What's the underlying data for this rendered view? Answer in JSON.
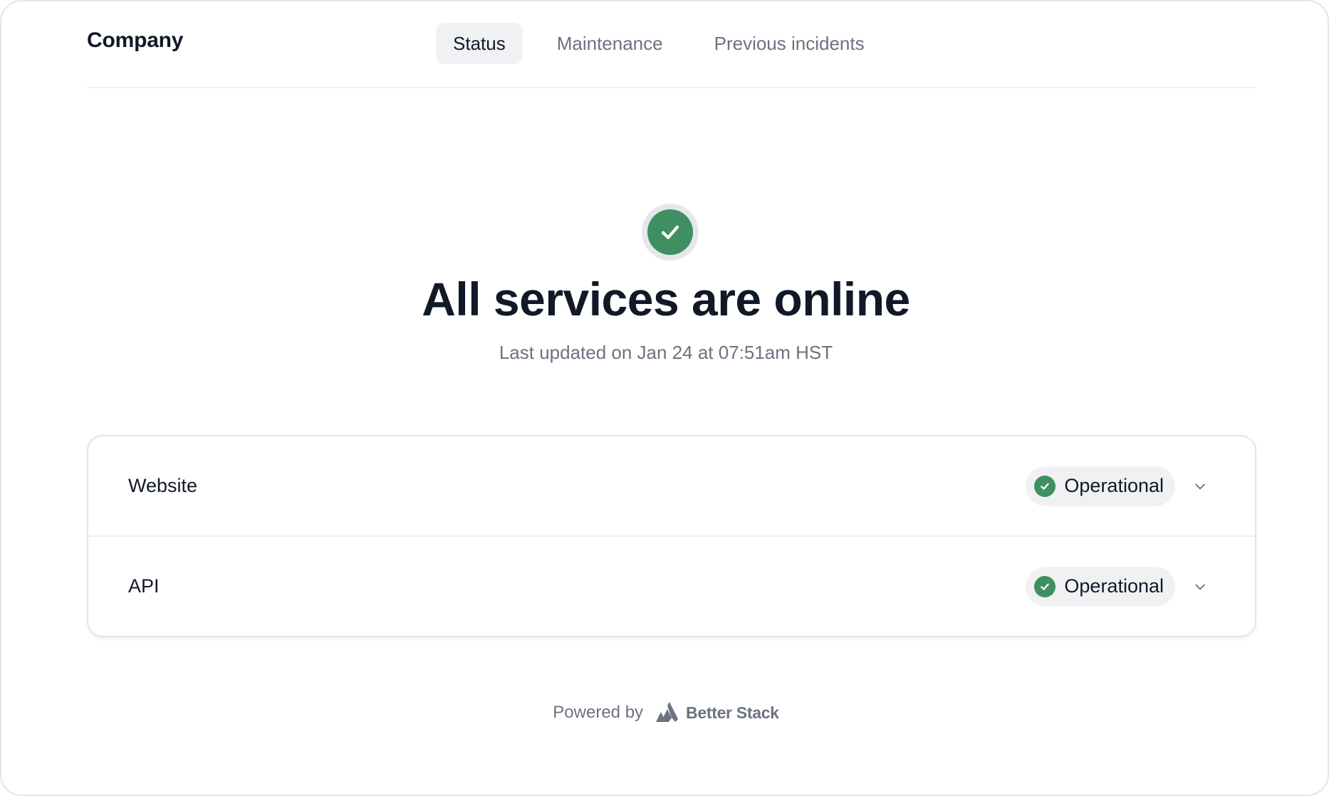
{
  "header": {
    "brand": "Company",
    "tabs": [
      {
        "label": "Status",
        "active": true
      },
      {
        "label": "Maintenance",
        "active": false
      },
      {
        "label": "Previous incidents",
        "active": false
      }
    ]
  },
  "hero": {
    "icon": "check-circle-icon",
    "title": "All services are online",
    "subtitle": "Last updated on Jan 24 at 07:51am HST"
  },
  "services": [
    {
      "name": "Website",
      "status": "Operational"
    },
    {
      "name": "API",
      "status": "Operational"
    }
  ],
  "footer": {
    "powered_by": "Powered by",
    "brand": "Better Stack"
  },
  "colors": {
    "operational": "#3f8f62",
    "muted_text": "#6b7280",
    "active_tab_bg": "#f0f1f3"
  }
}
